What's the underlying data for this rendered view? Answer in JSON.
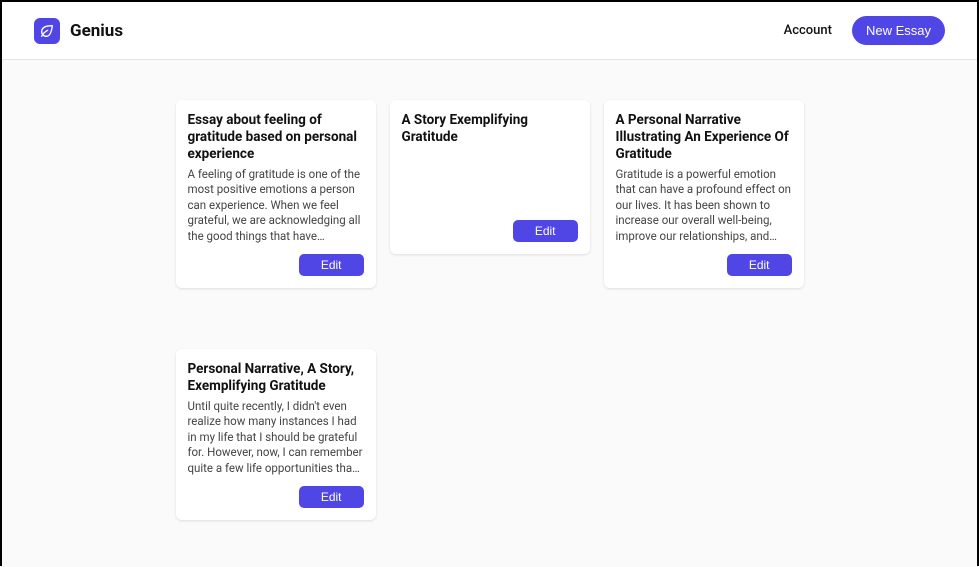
{
  "header": {
    "brand_name": "Genius",
    "account_label": "Account",
    "new_essay_label": "New Essay"
  },
  "essays": [
    {
      "title": "Essay about feeling of gratitude based on personal experience",
      "body": "A feeling of gratitude is one of the most positive emotions a person can experience. When we feel grateful, we are acknowledging all the good things that have happened to us. This can…",
      "edit_label": "Edit"
    },
    {
      "title": "A Story Exemplifying Gratitude",
      "body": "",
      "edit_label": "Edit"
    },
    {
      "title": "A Personal Narrative Illustrating An Experience Of Gratitude",
      "body": "Gratitude is a powerful emotion that can have a profound effect on our lives. It has been shown to increase our overall well-being, improve our relationships, and even boost our…",
      "edit_label": "Edit"
    },
    {
      "title": "Personal Narrative, A Story, Exemplifying Gratitude",
      "body": "Until quite recently, I didn't even realize how many instances I had in my life that I should be grateful for. However, now, I can remember quite a few life opportunities that I should be grateful…",
      "edit_label": "Edit"
    }
  ]
}
